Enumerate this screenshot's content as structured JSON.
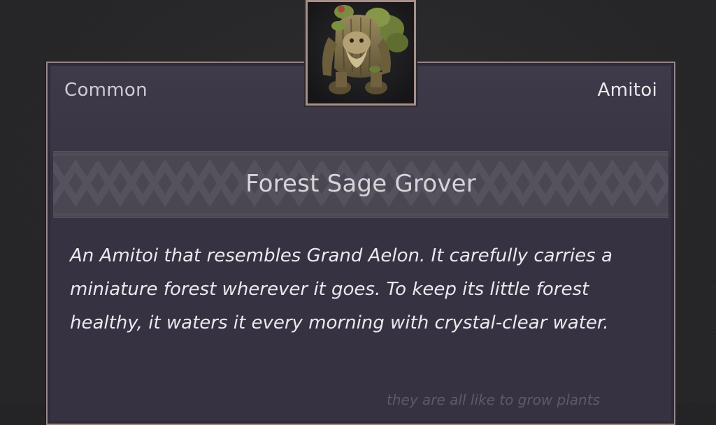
{
  "card": {
    "rarity": "Common",
    "category": "Amitoi",
    "name": "Forest Sage Grover",
    "description": "An Amitoi that resembles Grand Aelon. It carefully carries a miniature forest wherever it goes. To keep its little forest healthy, it waters it every morning with crystal-clear water.",
    "footnote": "they are all like to grow plants"
  },
  "portrait": {
    "icon": "forest-sage-grover-portrait"
  },
  "colors": {
    "background": "#252426",
    "card": "#363241",
    "border": "#9a8784",
    "banner": "#4a4752"
  }
}
